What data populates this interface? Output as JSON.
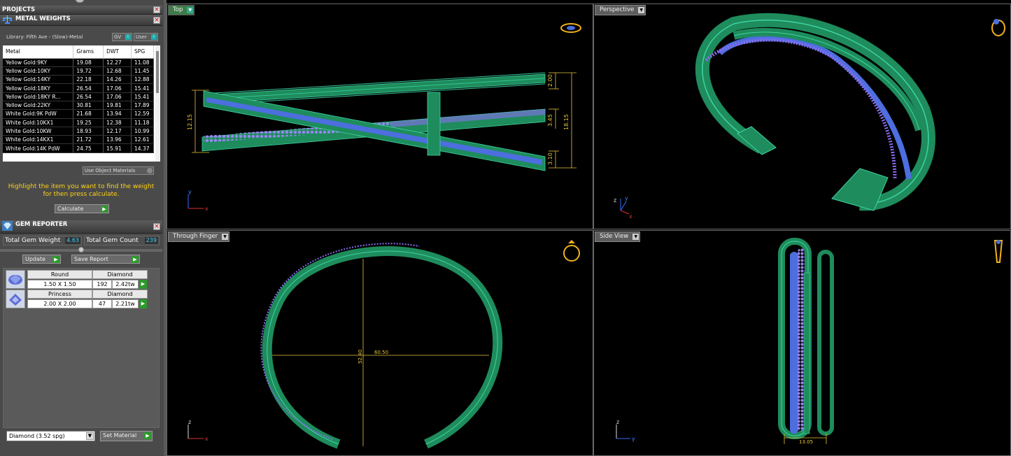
{
  "colors": {
    "metal": "#1e8c5c",
    "metal_hi": "#33c39c",
    "stones": "#8a6cf0",
    "channel": "#4c6ede",
    "dimension": "#e6c53c",
    "active_view": "#3f7a4a",
    "instruction": "#ffd21a",
    "value_text": "#38d0ff"
  },
  "left_panel": {
    "projects_title": "PROJECTS",
    "metal_weights": {
      "title": "METAL WEIGHTS",
      "library_label": "Library: Fifth Ave - (Slow)-Metal",
      "gv_label": "GV",
      "user_label": "User",
      "columns": [
        "Metal",
        "Grams",
        "DWT",
        "SPG"
      ],
      "rows": [
        [
          "Yellow Gold:9KY",
          "19.08",
          "12.27",
          "11.08"
        ],
        [
          "Yellow Gold:10KY",
          "19.72",
          "12.68",
          "11.45"
        ],
        [
          "Yellow Gold:14KY",
          "22.18",
          "14.26",
          "12.88"
        ],
        [
          "Yellow Gold:18KY",
          "26.54",
          "17.06",
          "15.41"
        ],
        [
          "Yellow Gold:18KY R...",
          "26.54",
          "17.06",
          "15.41"
        ],
        [
          "Yellow Gold:22KY",
          "30.81",
          "19.81",
          "17.89"
        ],
        [
          "White Gold:9K PdW",
          "21.68",
          "13.94",
          "12.59"
        ],
        [
          "White Gold:10KX1",
          "19.25",
          "12.38",
          "11.18"
        ],
        [
          "White Gold:10KW",
          "18.93",
          "12.17",
          "10.99"
        ],
        [
          "White Gold:14KX1",
          "21.72",
          "13.96",
          "12.61"
        ],
        [
          "White Gold:14K PdW",
          "24.75",
          "15.91",
          "14.37"
        ]
      ],
      "use_object_materials": "Use Object Materials",
      "instruction": "Highlight the item you want to find the weight for then press calculate.",
      "calculate_label": "Calculate"
    },
    "gem_reporter": {
      "title": "GEM REPORTER",
      "total_weight_label": "Total Gem Weight",
      "total_weight": "4.63",
      "total_count_label": "Total Gem Count",
      "total_count": "239",
      "update_label": "Update",
      "save_report_label": "Save Report",
      "gems": [
        {
          "shape": "Round",
          "size": "1.50 X 1.50",
          "material": "Diamond",
          "count": "192",
          "weight": "2.42tw"
        },
        {
          "shape": "Princess",
          "size": "2.00 X 2.00",
          "material": "Diamond",
          "count": "47",
          "weight": "2.21tw"
        }
      ],
      "material_select": "Diamond    (3.52 spg)",
      "set_material_label": "Set Material"
    }
  },
  "viewports": {
    "top": {
      "label": "Top",
      "dims": [
        "2.00",
        "12.15",
        "3.45",
        "18.15",
        "3.10"
      ],
      "axis_x": "x",
      "axis_y": "y"
    },
    "perspective": {
      "label": "Perspective",
      "axis_x": "x",
      "axis_y": "y",
      "axis_z": "z"
    },
    "through_finger": {
      "label": "Through Finger",
      "dims": [
        "60.50",
        "52.40"
      ],
      "axis_x": "x",
      "axis_z": "z"
    },
    "side": {
      "label": "Side View",
      "dims": [
        "13.05"
      ],
      "axis_y": "y",
      "axis_z": "z"
    }
  }
}
